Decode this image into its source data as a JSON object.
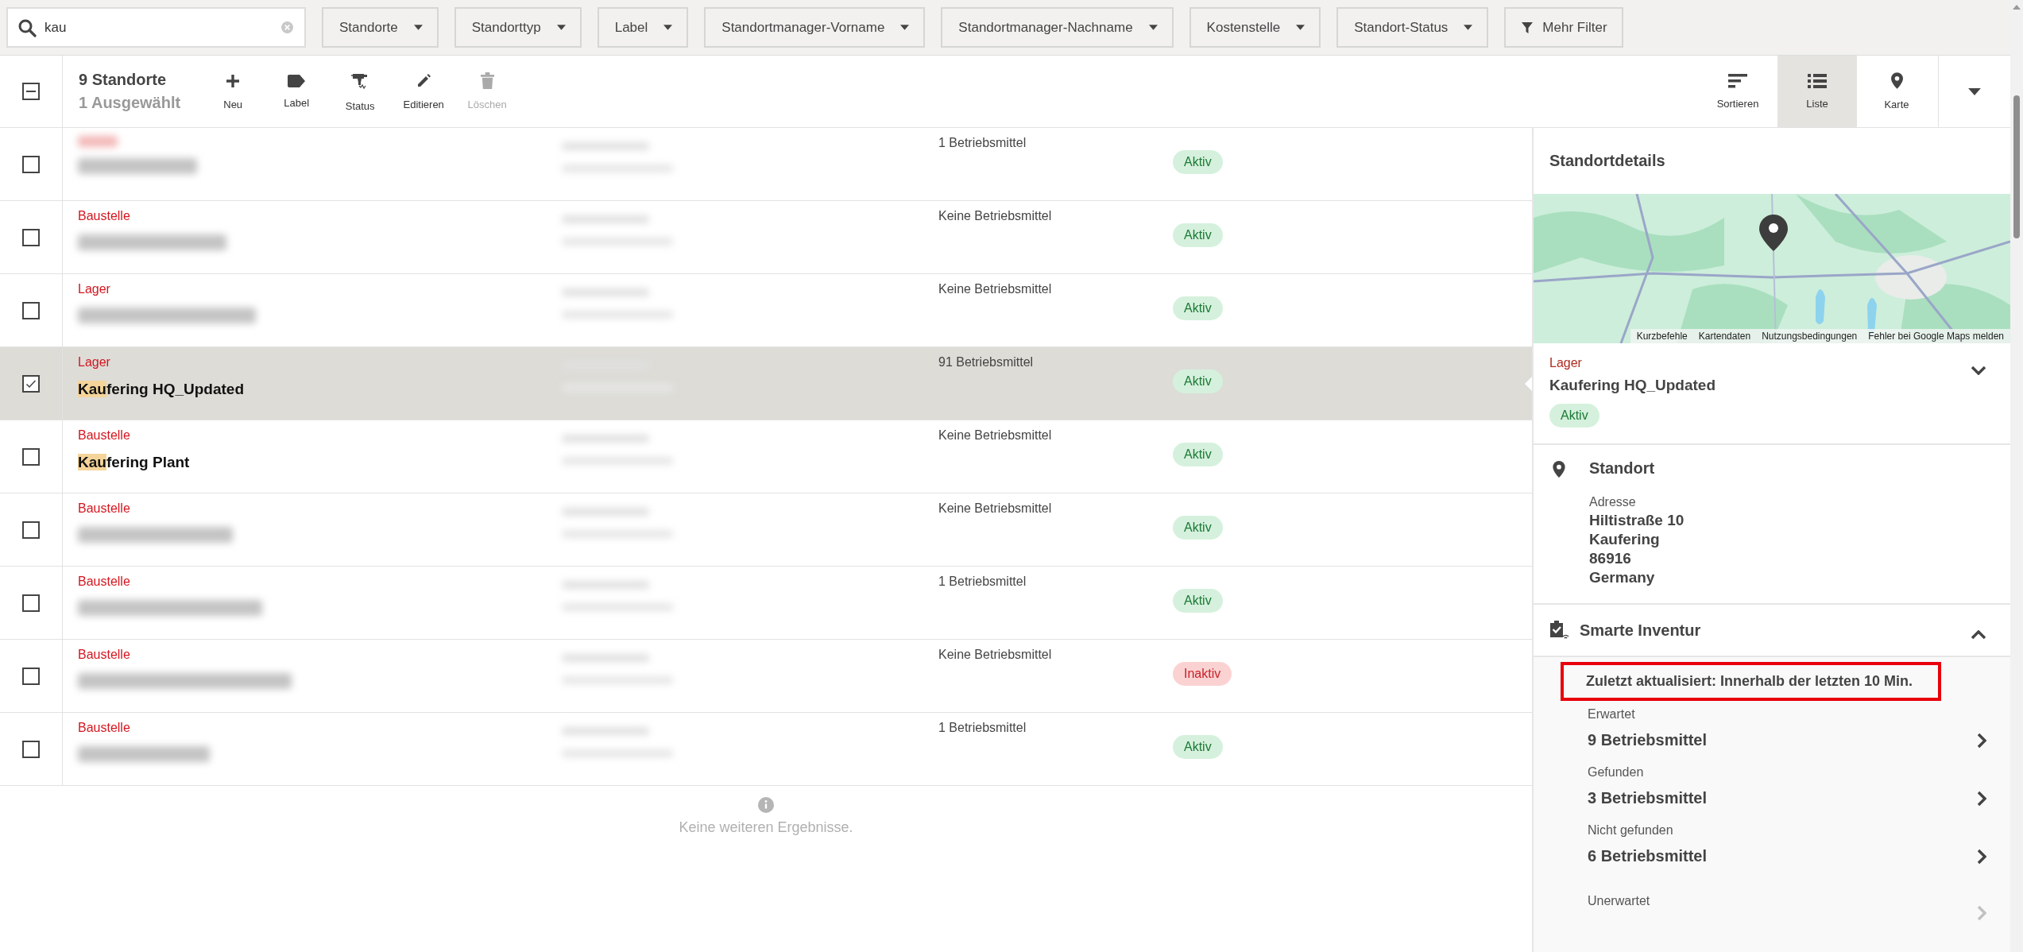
{
  "search": {
    "value": "kau"
  },
  "filters": [
    {
      "label": "Standorte",
      "kind": "dropdown"
    },
    {
      "label": "Standorttyp",
      "kind": "dropdown"
    },
    {
      "label": "Label",
      "kind": "dropdown"
    },
    {
      "label": "Standortmanager-Vorname",
      "kind": "dropdown"
    },
    {
      "label": "Standortmanager-Nachname",
      "kind": "dropdown"
    },
    {
      "label": "Kostenstelle",
      "kind": "dropdown"
    },
    {
      "label": "Standort-Status",
      "kind": "dropdown"
    },
    {
      "label": "Mehr Filter",
      "kind": "more"
    }
  ],
  "selection": {
    "indeterminate": true,
    "count": "9 Standorte",
    "selected": "1 Ausgewählt"
  },
  "actions": [
    {
      "label": "Neu",
      "kind": "plus",
      "disabled": false
    },
    {
      "label": "Label",
      "kind": "tag",
      "disabled": false
    },
    {
      "label": "Status",
      "kind": "drill",
      "disabled": false
    },
    {
      "label": "Editieren",
      "kind": "pencil",
      "disabled": false
    },
    {
      "label": "Löschen",
      "kind": "trash",
      "disabled": true
    }
  ],
  "views": [
    {
      "label": "Sortieren",
      "kind": "sort",
      "selected": false
    },
    {
      "label": "Liste",
      "kind": "list",
      "selected": true
    },
    {
      "label": "Karte",
      "kind": "pin",
      "selected": false
    }
  ],
  "rows": [
    {
      "type_redacted": true,
      "name_redacted": true,
      "assets": "1 Betriebsmittel",
      "status": "Aktiv",
      "inactive": false,
      "checked": false,
      "selected": false
    },
    {
      "type": "Baustelle",
      "name_redacted": true,
      "assets": "Keine Betriebsmittel",
      "status": "Aktiv",
      "inactive": false,
      "checked": false,
      "selected": false
    },
    {
      "type": "Lager",
      "name_redacted": true,
      "assets": "Keine Betriebsmittel",
      "status": "Aktiv",
      "inactive": false,
      "checked": false,
      "selected": false
    },
    {
      "type": "Lager",
      "name_match": "Kau",
      "name_rest": "fering HQ_Updated",
      "assets": "91 Betriebsmittel",
      "status": "Aktiv",
      "inactive": false,
      "checked": true,
      "selected": true
    },
    {
      "type": "Baustelle",
      "name_match": "Kau",
      "name_rest": "fering Plant",
      "assets": "Keine Betriebsmittel",
      "status": "Aktiv",
      "inactive": false,
      "checked": false,
      "selected": false
    },
    {
      "type": "Baustelle",
      "name_redacted": true,
      "assets": "Keine Betriebsmittel",
      "status": "Aktiv",
      "inactive": false,
      "checked": false,
      "selected": false
    },
    {
      "type": "Baustelle",
      "name_redacted": true,
      "assets": "1 Betriebsmittel",
      "status": "Aktiv",
      "inactive": false,
      "checked": false,
      "selected": false
    },
    {
      "type": "Baustelle",
      "name_redacted": true,
      "assets": "Keine Betriebsmittel",
      "status": "Inaktiv",
      "inactive": true,
      "checked": false,
      "selected": false
    },
    {
      "type": "Baustelle",
      "name_redacted": true,
      "assets": "1 Betriebsmittel",
      "status": "Aktiv",
      "inactive": false,
      "checked": false,
      "selected": false
    }
  ],
  "list_footer": "Keine weiteren Ergebnisse.",
  "details": {
    "title": "Standortdetails",
    "map": {
      "links": [
        "Kurzbefehle",
        "Kartendaten",
        "Nutzungsbedingungen",
        "Fehler bei Google Maps melden"
      ]
    },
    "type": "Lager",
    "name": "Kaufering HQ_Updated",
    "status": "Aktiv",
    "inactive": false,
    "expanded": false,
    "location": {
      "title": "Standort",
      "address_label": "Adresse",
      "address_lines": [
        "Hiltistraße 10",
        "Kaufering",
        "86916",
        "Germany"
      ]
    },
    "inventory": {
      "title": "Smarte Inventur",
      "expanded": true,
      "last_updated": "Zuletzt aktualisiert: Innerhalb der letzten 10 Min.",
      "highlighted": true,
      "items": [
        {
          "label": "Erwartet",
          "value": "9 Betriebsmittel",
          "disabled": false
        },
        {
          "label": "Gefunden",
          "value": "3 Betriebsmittel",
          "disabled": false
        },
        {
          "label": "Nicht gefunden",
          "value": "6 Betriebsmittel",
          "disabled": false
        },
        {
          "label": "Unerwartet",
          "disabled": true
        }
      ]
    }
  }
}
